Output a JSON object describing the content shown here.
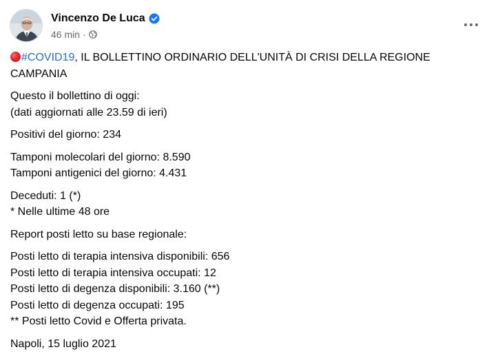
{
  "author": {
    "name": "Vincenzo De Luca",
    "verified": true,
    "time": "46 min",
    "separator": "·",
    "audience_icon": "globe-icon"
  },
  "post": {
    "hashtag": "#COVID19",
    "title_rest": ", IL BOLLETTINO ORDINARIO DELL'UNITÀ DI CRISI DELLA REGIONE",
    "title_line2": "CAMPANIA",
    "intro_1": "Questo il bollettino di oggi:",
    "intro_2": "(dati aggiornati alle 23.59 di ieri)",
    "positivi": "Positivi del giorno: 234",
    "tamponi_molecolari": "Tamponi molecolari del giorno: 8.590",
    "tamponi_antigenici": "Tamponi antigenici del giorno: 4.431",
    "deceduti": "Deceduti: 1 (*)",
    "deceduti_note": "* Nelle ultime 48 ore",
    "report": "Report posti letto su base regionale:",
    "ti_disponibili": "Posti letto di terapia intensiva disponibili: 656",
    "ti_occupati": "Posti letto di terapia intensiva occupati: 12",
    "deg_disponibili": "Posti letto di degenza disponibili: 3.160 (**)",
    "deg_occupati": "Posti letto di degenza occupati: 195",
    "posti_note": "** Posti letto Covid e Offerta privata.",
    "signoff": "Napoli, 15 luglio 2021"
  },
  "colors": {
    "hashtag": "#216fdb",
    "verified": "#1877f2",
    "secondary_text": "#65676b",
    "red_circle": "#e0262b"
  }
}
